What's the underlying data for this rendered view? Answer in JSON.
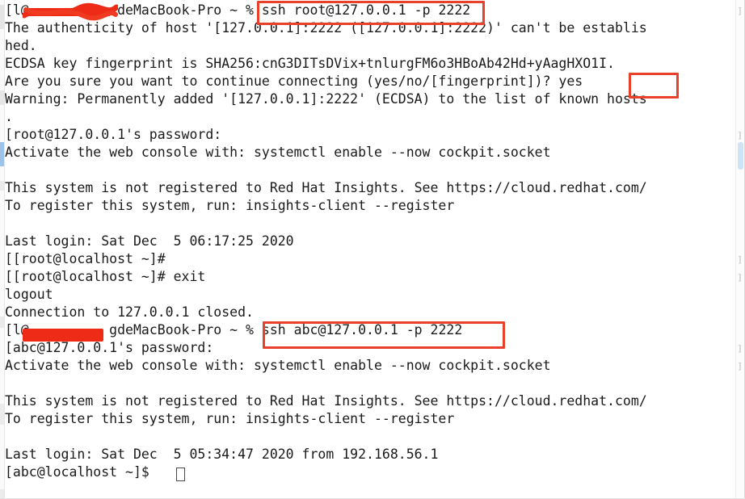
{
  "window": {
    "title": "Terminal — ssh session",
    "background_color": "#ffffff",
    "text_color": "#1a1a1a",
    "highlight_color": "#e8402a",
    "redaction_color": "#ee2b16",
    "font_size_px": 16.5,
    "line_height_px": 22
  },
  "terminal": {
    "lines": [
      {
        "prefix": "[l@",
        "suffix": "deMacBook-Pro ~ % ",
        "command": "ssh root@127.0.0.1 -p 2222",
        "redacted": true
      },
      {
        "text": "The authenticity of host '[127.0.0.1]:2222 ([127.0.0.1]:2222)' can't be establis"
      },
      {
        "text": "hed."
      },
      {
        "text": "ECDSA key fingerprint is SHA256:cnG3DITsDVix+tnlurgFM6o3HBoAb42Hd+yAagHXO1I."
      },
      {
        "text": "Are you sure you want to continue connecting (yes/no/[fingerprint])? yes"
      },
      {
        "text": "Warning: Permanently added '[127.0.0.1]:2222' (ECDSA) to the list of known hosts"
      },
      {
        "text": "."
      },
      {
        "text": "[root@127.0.0.1's password:"
      },
      {
        "text": "Activate the web console with: systemctl enable --now cockpit.socket"
      },
      {
        "text": ""
      },
      {
        "text": "This system is not registered to Red Hat Insights. See https://cloud.redhat.com/"
      },
      {
        "text": "To register this system, run: insights-client --register"
      },
      {
        "text": ""
      },
      {
        "text": "Last login: Sat Dec  5 06:17:25 2020"
      },
      {
        "text": "[[root@localhost ~]#"
      },
      {
        "text": "[[root@localhost ~]# exit"
      },
      {
        "text": "logout"
      },
      {
        "text": "Connection to 127.0.0.1 closed."
      },
      {
        "prefix": "[l@",
        "suffix": "gdeMacBook-Pro ~ % ",
        "command": "ssh abc@127.0.0.1 -p 2222",
        "redacted": true
      },
      {
        "text": "[abc@127.0.0.1's password:"
      },
      {
        "text": "Activate the web console with: systemctl enable --now cockpit.socket"
      },
      {
        "text": ""
      },
      {
        "text": "This system is not registered to Red Hat Insights. See https://cloud.redhat.com/"
      },
      {
        "text": "To register this system, run: insights-client --register"
      },
      {
        "text": ""
      },
      {
        "text": "Last login: Sat Dec  5 05:34:47 2020 from 192.168.56.1"
      },
      {
        "text": "[abc@localhost ~]$ "
      }
    ],
    "wrap_markers": [
      "]",
      "]",
      "]",
      "]",
      "]",
      "]",
      "]"
    ],
    "cursor": {
      "visible": true,
      "shape": "hollow-block"
    }
  },
  "annotations": {
    "boxes": [
      {
        "label": "ssh root@127.0.0.1 -p 2222",
        "name": "highlight-ssh-root-command"
      },
      {
        "label": "yes",
        "name": "highlight-yes-answer"
      },
      {
        "label": "ssh abc@127.0.0.1 -p 2222",
        "name": "highlight-ssh-abc-command"
      }
    ]
  },
  "watermark": {
    "text": ""
  }
}
